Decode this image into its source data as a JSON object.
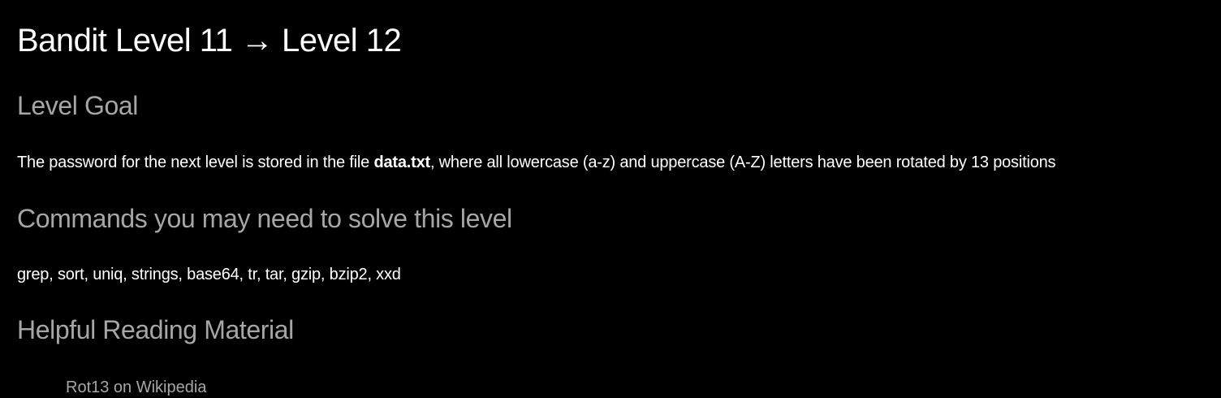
{
  "page": {
    "title": "Bandit Level 11 → Level 12"
  },
  "goal": {
    "heading": "Level Goal",
    "text_before": "The password for the next level is stored in the file ",
    "filename": "data.txt",
    "text_after": ", where all lowercase (a-z) and uppercase (A-Z) letters have been rotated by 13 positions"
  },
  "commands": {
    "heading": "Commands you may need to solve this level",
    "list": "grep, sort, uniq, strings, base64, tr, tar, gzip, bzip2, xxd"
  },
  "reading": {
    "heading": "Helpful Reading Material",
    "links": [
      {
        "label": "Rot13 on Wikipedia"
      }
    ]
  },
  "colors": {
    "background": "#000000",
    "text": "#ffffff",
    "heading_muted": "#a6a6a6",
    "link": "#a6a6a6"
  }
}
